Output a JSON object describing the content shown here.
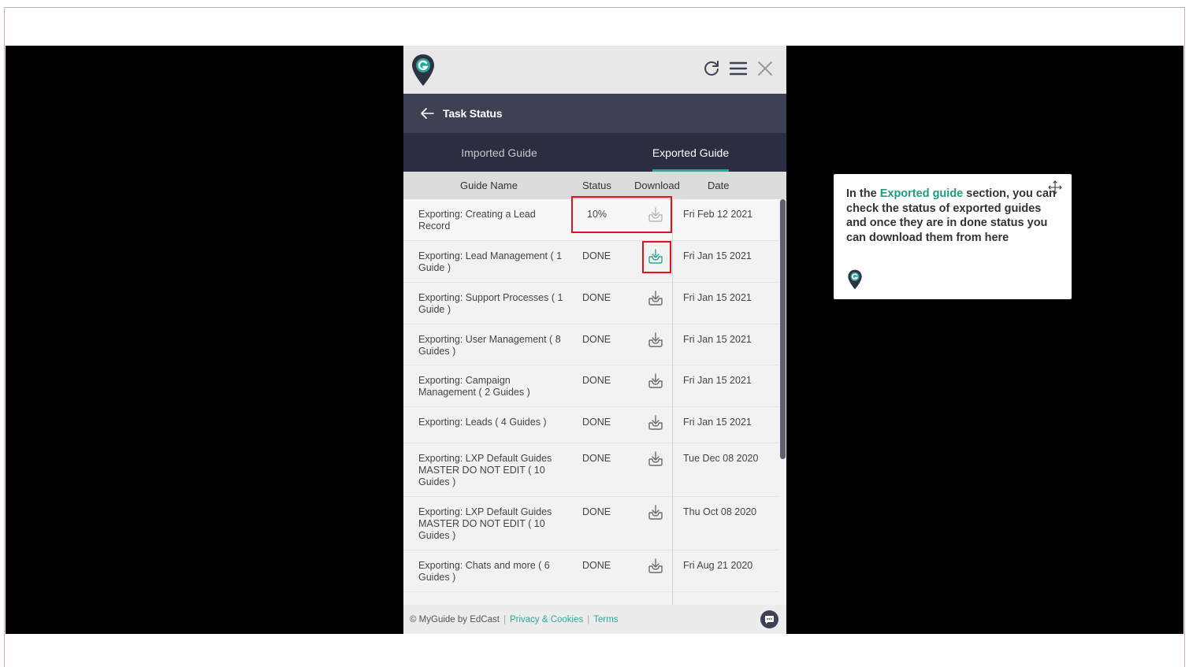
{
  "panel": {
    "title": "Task Status",
    "tabs": [
      {
        "label": "Imported Guide",
        "active": false
      },
      {
        "label": "Exported Guide",
        "active": true
      }
    ],
    "columns": {
      "name": "Guide Name",
      "status": "Status",
      "download": "Download",
      "date": "Date"
    },
    "rows": [
      {
        "name": "Exporting: Creating a Lead Record",
        "status": "10%",
        "date": "Fri Feb 12 2021",
        "download_enabled": false
      },
      {
        "name": "Exporting: Lead Management ( 1 Guide )",
        "status": "DONE",
        "date": "Fri Jan 15 2021",
        "download_enabled": true
      },
      {
        "name": "Exporting: Support Processes ( 1 Guide )",
        "status": "DONE",
        "date": "Fri Jan 15 2021",
        "download_enabled": true
      },
      {
        "name": "Exporting: User Management ( 8 Guides )",
        "status": "DONE",
        "date": "Fri Jan 15 2021",
        "download_enabled": true
      },
      {
        "name": "Exporting: Campaign Management ( 2 Guides )",
        "status": "DONE",
        "date": "Fri Jan 15 2021",
        "download_enabled": true
      },
      {
        "name": "Exporting: Leads ( 4 Guides )",
        "status": "DONE",
        "date": "Fri Jan 15 2021",
        "download_enabled": true
      },
      {
        "name": "Exporting: LXP Default Guides MASTER DO NOT EDIT ( 10 Guides )",
        "status": "DONE",
        "date": "Tue Dec 08 2020",
        "download_enabled": true
      },
      {
        "name": "Exporting: LXP Default Guides MASTER DO NOT EDIT ( 10 Guides )",
        "status": "DONE",
        "date": "Thu Oct 08 2020",
        "download_enabled": true
      },
      {
        "name": "Exporting: Chats and more ( 6 Guides )",
        "status": "DONE",
        "date": "Fri Aug 21 2020",
        "download_enabled": true
      }
    ],
    "footer": {
      "brand": "© MyGuide by EdCast",
      "privacy": "Privacy & Cookies",
      "terms": "Terms",
      "separator": "|"
    }
  },
  "tooltip": {
    "text_before": "In the ",
    "highlight": "Exported guide",
    "text_after": " section, you can check the status of exported guides and once they are in done status you can download them from here"
  },
  "icons": {
    "logo": "myguide-logo-icon",
    "refresh": "refresh-icon",
    "menu": "hamburger-menu-icon",
    "close": "close-icon",
    "back": "back-arrow-icon",
    "download": "download-icon",
    "chat": "chat-icon",
    "move": "move-icon"
  },
  "colors": {
    "accent": "#2aa89a",
    "header_dark": "#3e4154",
    "tabs_dark": "#2b2e40",
    "highlight_border": "#e0141e",
    "tooltip_accent": "#1f9a80"
  }
}
